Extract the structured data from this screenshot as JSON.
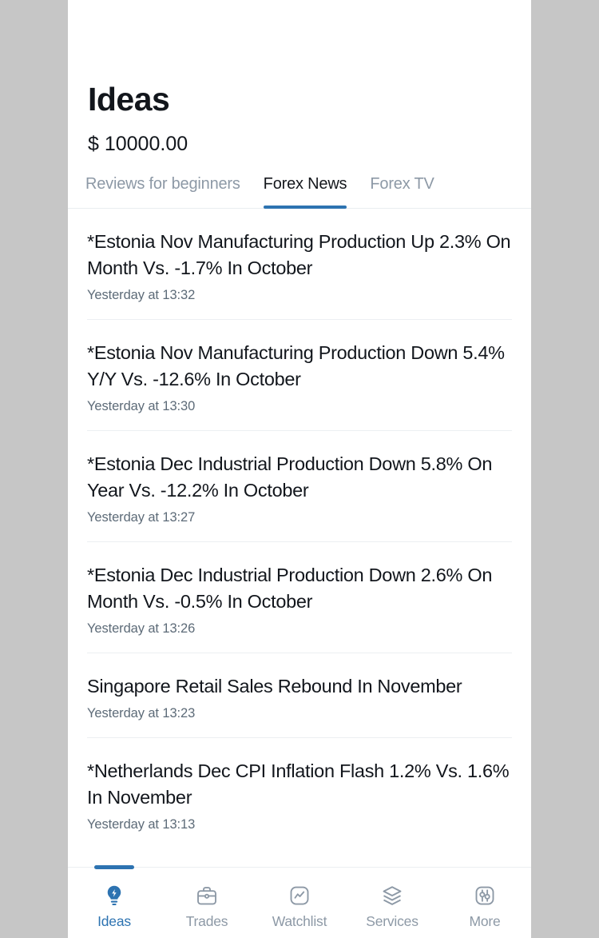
{
  "header": {
    "title": "Ideas",
    "balance": "$ 10000.00"
  },
  "tabs": [
    {
      "label": "Reviews for beginners",
      "active": false
    },
    {
      "label": "Forex News",
      "active": true
    },
    {
      "label": "Forex TV",
      "active": false
    }
  ],
  "news": [
    {
      "headline": "*Estonia Nov Manufacturing Production Up 2.3% On Month Vs. -1.7% In October",
      "time": "Yesterday at 13:32"
    },
    {
      "headline": "*Estonia Nov Manufacturing Production Down 5.4% Y/Y Vs. -12.6% In October",
      "time": "Yesterday at 13:30"
    },
    {
      "headline": "*Estonia Dec Industrial Production Down 5.8% On Year Vs. -12.2% In October",
      "time": "Yesterday at 13:27"
    },
    {
      "headline": "*Estonia Dec Industrial Production Down 2.6% On Month Vs. -0.5% In October",
      "time": "Yesterday at 13:26"
    },
    {
      "headline": "Singapore Retail Sales Rebound In November",
      "time": "Yesterday at 13:23"
    },
    {
      "headline": "*Netherlands Dec CPI Inflation Flash 1.2% Vs. 1.6% In November",
      "time": "Yesterday at 13:13"
    }
  ],
  "bottom_nav": [
    {
      "label": "Ideas",
      "icon": "lightbulb-icon",
      "active": true
    },
    {
      "label": "Trades",
      "icon": "briefcase-icon",
      "active": false
    },
    {
      "label": "Watchlist",
      "icon": "chart-wave-icon",
      "active": false
    },
    {
      "label": "Services",
      "icon": "layers-icon",
      "active": false
    },
    {
      "label": "More",
      "icon": "sliders-icon",
      "active": false
    }
  ],
  "colors": {
    "accent": "#2d73b1",
    "muted_text": "#8d99a6",
    "primary_text": "#12161c",
    "timestamp_text": "#5d6b78",
    "backdrop": "#c6c6c6",
    "divider": "#eceff2"
  }
}
